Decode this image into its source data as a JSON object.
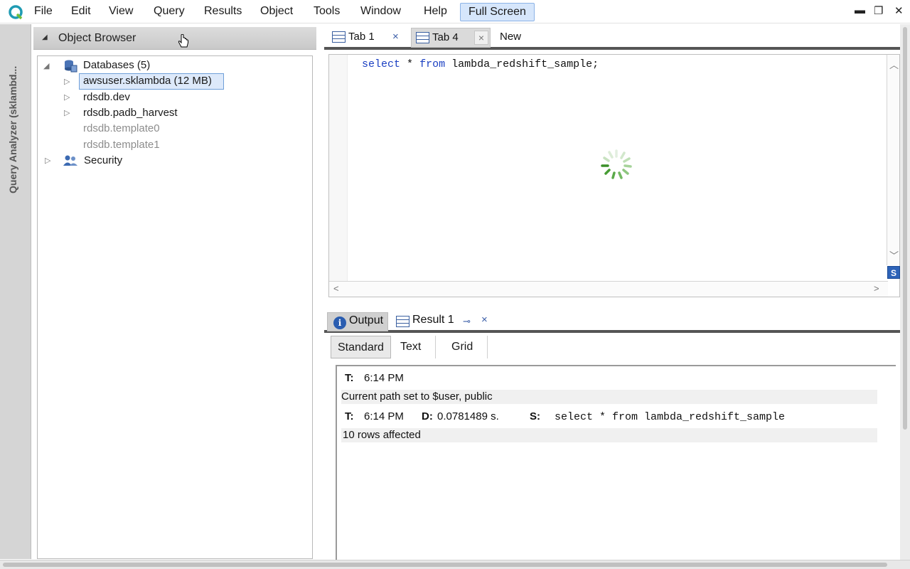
{
  "menu": {
    "items": [
      "File",
      "Edit",
      "View",
      "Query",
      "Results",
      "Object",
      "Tools",
      "Window",
      "Help"
    ],
    "fullscreen_label": "Full Screen"
  },
  "window_controls": {
    "minimize": "▬",
    "restore": "❐",
    "close": "✕"
  },
  "left_strip": {
    "label": "Query Analyzer (sklambd..."
  },
  "object_browser": {
    "title": "Object Browser",
    "databases_label": "Databases (5)",
    "nodes": [
      {
        "label": "awsuser.sklambda (12 MB)",
        "selected": true
      },
      {
        "label": "rdsdb.dev"
      },
      {
        "label": "rdsdb.padb_harvest"
      },
      {
        "label": "rdsdb.template0",
        "dim": true
      },
      {
        "label": "rdsdb.template1",
        "dim": true
      }
    ],
    "security_label": "Security"
  },
  "editor_tabs": [
    {
      "label": "Tab 1",
      "close": "×"
    },
    {
      "label": "Tab 4",
      "close": "×"
    }
  ],
  "new_tab_label": "New",
  "editor": {
    "kw_select": "select",
    "star": "*",
    "kw_from": "from",
    "table": "lambda_redshift_sample;",
    "sql_icon": "S"
  },
  "result_tabs": {
    "output_label": "Output",
    "result_label": "Result 1",
    "pin": "⊸",
    "close": "×"
  },
  "view_buttons": [
    "Standard",
    "Text",
    "Grid"
  ],
  "output": {
    "row1": {
      "t_label": "T:",
      "time": "6:14 PM"
    },
    "row1_msg": "Current path set to $user, public",
    "row2": {
      "t_label": "T:",
      "time": "6:14 PM",
      "d_label": "D:",
      "duration": "0.0781489 s.",
      "s_label": "S:",
      "statement": "select * from lambda_redshift_sample"
    },
    "row2_msg": "10 rows affected"
  },
  "icons": {
    "app": "app-logo-icon",
    "db": "database-icon",
    "security": "users-icon",
    "spinner": "spinner-icon"
  }
}
